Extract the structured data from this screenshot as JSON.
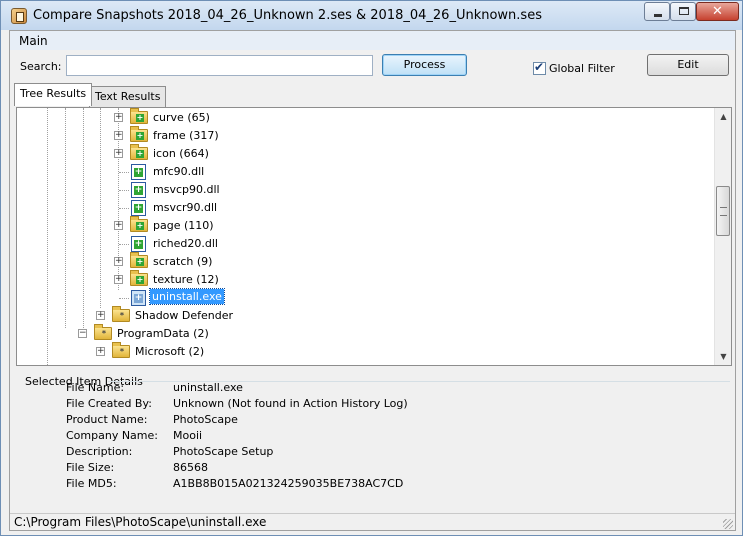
{
  "window": {
    "title": "Compare Snapshots 2018_04_26_Unknown 2.ses & 2018_04_26_Unknown.ses",
    "close_glyph": "✕"
  },
  "menu": {
    "main": "Main"
  },
  "search": {
    "label": "Search:",
    "value": "",
    "placeholder": ""
  },
  "buttons": {
    "process": "Process",
    "edit": "Edit"
  },
  "global_filter": {
    "label": "Global Filter",
    "checked": true
  },
  "tabs": {
    "tree": "Tree Results",
    "text": "Text Results",
    "active": "Tree Results"
  },
  "tree": {
    "nodes": [
      {
        "label": "curve (65)",
        "type": "folder-green",
        "expander": "+"
      },
      {
        "label": "frame (317)",
        "type": "folder-green",
        "expander": "+"
      },
      {
        "label": "icon (664)",
        "type": "folder-green",
        "expander": "+"
      },
      {
        "label": "mfc90.dll",
        "type": "file-green",
        "expander": ""
      },
      {
        "label": "msvcp90.dll",
        "type": "file-green",
        "expander": ""
      },
      {
        "label": "msvcr90.dll",
        "type": "file-green",
        "expander": ""
      },
      {
        "label": "page (110)",
        "type": "folder-green",
        "expander": "+"
      },
      {
        "label": "riched20.dll",
        "type": "file-green",
        "expander": ""
      },
      {
        "label": "scratch (9)",
        "type": "folder-green",
        "expander": "+"
      },
      {
        "label": "texture (12)",
        "type": "folder-green",
        "expander": "+"
      },
      {
        "label": "uninstall.exe",
        "type": "file-selected",
        "expander": "",
        "selected": true
      },
      {
        "label": "Shadow Defender",
        "type": "folder-star",
        "expander": "+"
      },
      {
        "label": "ProgramData (2)",
        "type": "folder-star",
        "expander": "−"
      },
      {
        "label": "Microsoft (2)",
        "type": "folder-star",
        "expander": "+"
      }
    ]
  },
  "details": {
    "header": "Selected Item Details",
    "fields": [
      {
        "label": "File Name:",
        "value": "uninstall.exe"
      },
      {
        "label": "File Created By:",
        "value": "Unknown (Not found in Action History Log)"
      },
      {
        "label": "Product Name:",
        "value": "PhotoScape"
      },
      {
        "label": "Company Name:",
        "value": "Mooii"
      },
      {
        "label": "Description:",
        "value": "PhotoScape Setup"
      },
      {
        "label": "File Size:",
        "value": "86568"
      },
      {
        "label": "File MD5:",
        "value": "A1BB8B015A021324259035BE738AC7CD"
      }
    ]
  },
  "status": {
    "path": "C:\\Program Files\\PhotoScape\\uninstall.exe"
  }
}
